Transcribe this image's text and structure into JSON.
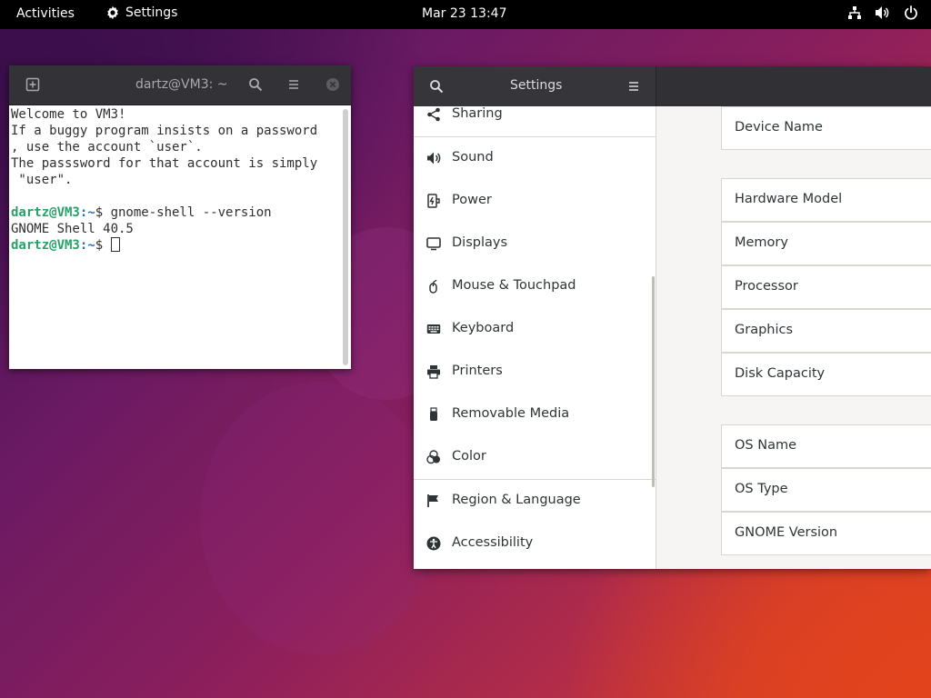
{
  "topbar": {
    "activities": "Activities",
    "app_menu_label": "Settings",
    "clock": "Mar 23  13:47",
    "tray_icons": [
      "network-icon",
      "volume-icon",
      "power-icon"
    ]
  },
  "terminal": {
    "title": "dartz@VM3: ~",
    "lines": [
      "Welcome to VM3!",
      "If a buggy program insists on a password",
      ", use the account `user`.",
      "The passsword for that account is simply",
      " \"user\".",
      ""
    ],
    "prompt_user": "dartz@VM3",
    "prompt_path_1": ":~",
    "prompt_symbol_1": "$ ",
    "command": "gnome-shell --version",
    "output": "GNOME Shell 40.5",
    "prompt_path_2": ":~",
    "prompt_symbol_2": "$ "
  },
  "settings": {
    "title": "Settings",
    "sidebar_items": [
      {
        "label": "Sharing",
        "icon": "sharing-icon"
      },
      {
        "label": "Sound",
        "icon": "sound-icon"
      },
      {
        "label": "Power",
        "icon": "power-icon"
      },
      {
        "label": "Displays",
        "icon": "displays-icon"
      },
      {
        "label": "Mouse & Touchpad",
        "icon": "mouse-icon"
      },
      {
        "label": "Keyboard",
        "icon": "keyboard-icon"
      },
      {
        "label": "Printers",
        "icon": "printer-icon"
      },
      {
        "label": "Removable Media",
        "icon": "usb-icon"
      },
      {
        "label": "Color",
        "icon": "color-icon"
      },
      {
        "label": "Region & Language",
        "icon": "flag-icon"
      },
      {
        "label": "Accessibility",
        "icon": "accessibility-icon"
      }
    ],
    "about_rows": {
      "device_name": "Device Name",
      "hardware_model": "Hardware Model",
      "memory": "Memory",
      "processor": "Processor",
      "graphics": "Graphics",
      "disk_capacity": "Disk Capacity",
      "os_name": "OS Name",
      "os_type": "OS Type",
      "gnome_version": "GNOME Version"
    }
  }
}
